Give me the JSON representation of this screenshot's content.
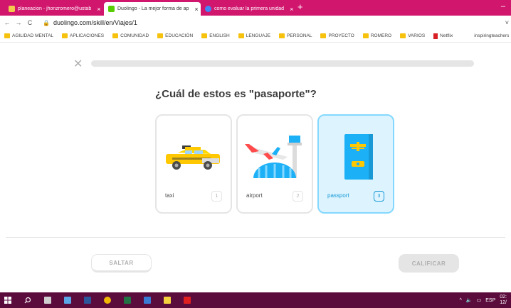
{
  "browser": {
    "tabs": [
      {
        "label": "planeacion - jhonzromero@ustab",
        "fav_color": "#f2c94c"
      },
      {
        "label": "Duolingo - La mejor forma de ap",
        "fav_color": "#58cc02"
      },
      {
        "label": "como evaluar la primera unidad",
        "fav_color": "#4285f4"
      }
    ],
    "url": "duolingo.com/skill/en/Viajes/1",
    "bookmarks": [
      "AGILIDAD MENTAL",
      "APLICACIONES",
      "COMUNIDAD",
      "EDUCACIÓN",
      "ENGLISH",
      "LENGUAJE",
      "PERSONAL",
      "PROYECTO",
      "ROMERO",
      "VARIOS",
      "Netflix",
      "inspiringteachers"
    ]
  },
  "lesson": {
    "progress": 0.0,
    "question": "¿Cuál de estos es \"pasaporte\"?",
    "options": [
      {
        "label": "taxi",
        "number": "1",
        "selected": false,
        "icon": "taxi-icon"
      },
      {
        "label": "airport",
        "number": "2",
        "selected": false,
        "icon": "airport-icon"
      },
      {
        "label": "passport",
        "number": "3",
        "selected": true,
        "icon": "passport-icon"
      }
    ],
    "skip_label": "SALTAR",
    "check_label": "CALIFICAR"
  },
  "taskbar": {
    "language": "ESP",
    "time": "02:",
    "date": "12/"
  },
  "colors": {
    "brand_pink": "#d1166e",
    "taskbar": "#5b0b3c",
    "selected_bg": "#ddf4ff",
    "selected_border": "#84d8ff",
    "selected_text": "#1899d6"
  }
}
